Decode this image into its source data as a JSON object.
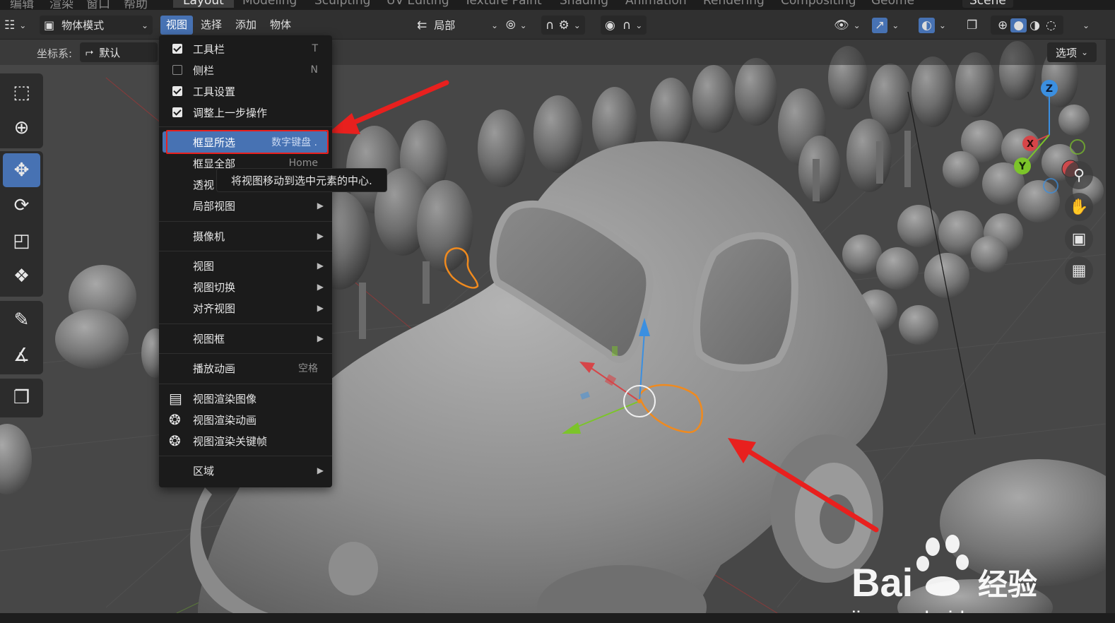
{
  "workspace_tabs": [
    "编辑",
    "渲染",
    "窗口",
    "帮助",
    "Layout",
    "Modeling",
    "Sculpting",
    "UV Editing",
    "Texture Paint",
    "Shading",
    "Animation",
    "Rendering",
    "Compositing",
    "Geome"
  ],
  "scene_name": "Scene",
  "header": {
    "mode": "物体模式",
    "menus": [
      "视图",
      "选择",
      "添加",
      "物体"
    ],
    "transform_orientation": "局部",
    "options_label": "选项"
  },
  "subheader": {
    "coord_label": "坐标系:",
    "coord_value": "默认"
  },
  "view_menu": {
    "items": [
      {
        "label": "工具栏",
        "shortcut": "T",
        "checkbox": "on"
      },
      {
        "label": "侧栏",
        "shortcut": "N",
        "checkbox": "off"
      },
      {
        "label": "工具设置",
        "checkbox": "on"
      },
      {
        "label": "调整上一步操作",
        "checkbox": "on"
      },
      {
        "label": "框显所选",
        "shortcut": "数字键盘 ."
      },
      {
        "label": "框显全部",
        "shortcut": "Home"
      },
      {
        "label": "透视"
      },
      {
        "label": "局部视图",
        "submenu": true
      },
      {
        "label": "摄像机",
        "submenu": true
      },
      {
        "label": "视图",
        "submenu": true
      },
      {
        "label": "视图切换",
        "submenu": true
      },
      {
        "label": "对齐视图",
        "submenu": true
      },
      {
        "label": "视图框",
        "submenu": true
      },
      {
        "label": "播放动画",
        "shortcut": "空格"
      },
      {
        "label": "视图渲染图像"
      },
      {
        "label": "视图渲染动画"
      },
      {
        "label": "视图渲染关键帧"
      },
      {
        "label": "区域",
        "submenu": true
      }
    ],
    "highlighted": "框显所选"
  },
  "tooltip": "将视图移动到选中元素的中心.",
  "gizmo_axes": {
    "x": "X",
    "y": "Y",
    "z": "Z"
  },
  "colors": {
    "accent": "#4772b3",
    "annotation_red": "#e8201e",
    "selection_orange": "#f08a1e",
    "axis_x": "#d64548",
    "axis_y": "#7cc42a",
    "axis_z": "#3b8fe0"
  },
  "watermark": {
    "brand_prefix": "Bai",
    "brand_suffix": "经验",
    "url": "jingyan.baidu.com"
  }
}
